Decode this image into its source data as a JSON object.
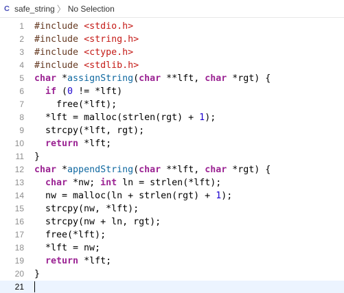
{
  "jump_bar": {
    "file_icon": "C",
    "file_name": "safe_string",
    "separator_icon": "chevron-right-icon",
    "separator_glyph": "〉",
    "selection": "No Selection"
  },
  "editor": {
    "current_line": 21,
    "lines": [
      {
        "number": "1",
        "tokens": [
          {
            "t": "pp",
            "v": "#include "
          },
          {
            "t": "str",
            "v": "<stdio.h>"
          }
        ]
      },
      {
        "number": "2",
        "tokens": [
          {
            "t": "pp",
            "v": "#include "
          },
          {
            "t": "str",
            "v": "<string.h>"
          }
        ]
      },
      {
        "number": "3",
        "tokens": [
          {
            "t": "pp",
            "v": "#include "
          },
          {
            "t": "str",
            "v": "<ctype.h>"
          }
        ]
      },
      {
        "number": "4",
        "tokens": [
          {
            "t": "pp",
            "v": "#include "
          },
          {
            "t": "str",
            "v": "<stdlib.h>"
          }
        ]
      },
      {
        "number": "5",
        "tokens": [
          {
            "t": "kw",
            "v": "char"
          },
          {
            "t": "plain",
            "v": " *"
          },
          {
            "t": "fn",
            "v": "assignString"
          },
          {
            "t": "plain",
            "v": "("
          },
          {
            "t": "kw",
            "v": "char"
          },
          {
            "t": "plain",
            "v": " **lft, "
          },
          {
            "t": "kw",
            "v": "char"
          },
          {
            "t": "plain",
            "v": " *rgt) {"
          }
        ]
      },
      {
        "number": "6",
        "tokens": [
          {
            "t": "plain",
            "v": "  "
          },
          {
            "t": "kw",
            "v": "if"
          },
          {
            "t": "plain",
            "v": " ("
          },
          {
            "t": "num",
            "v": "0"
          },
          {
            "t": "plain",
            "v": " != *lft)"
          }
        ]
      },
      {
        "number": "7",
        "tokens": [
          {
            "t": "plain",
            "v": "    free(*lft);"
          }
        ]
      },
      {
        "number": "8",
        "tokens": [
          {
            "t": "plain",
            "v": "  *lft = malloc(strlen(rgt) + "
          },
          {
            "t": "num",
            "v": "1"
          },
          {
            "t": "plain",
            "v": ");"
          }
        ]
      },
      {
        "number": "9",
        "tokens": [
          {
            "t": "plain",
            "v": "  strcpy(*lft, rgt);"
          }
        ]
      },
      {
        "number": "10",
        "tokens": [
          {
            "t": "plain",
            "v": "  "
          },
          {
            "t": "kw",
            "v": "return"
          },
          {
            "t": "plain",
            "v": " *lft;"
          }
        ]
      },
      {
        "number": "11",
        "tokens": [
          {
            "t": "plain",
            "v": "}"
          }
        ]
      },
      {
        "number": "12",
        "tokens": [
          {
            "t": "kw",
            "v": "char"
          },
          {
            "t": "plain",
            "v": " *"
          },
          {
            "t": "fn",
            "v": "appendString"
          },
          {
            "t": "plain",
            "v": "("
          },
          {
            "t": "kw",
            "v": "char"
          },
          {
            "t": "plain",
            "v": " **lft, "
          },
          {
            "t": "kw",
            "v": "char"
          },
          {
            "t": "plain",
            "v": " *rgt) {"
          }
        ]
      },
      {
        "number": "13",
        "tokens": [
          {
            "t": "plain",
            "v": "  "
          },
          {
            "t": "kw",
            "v": "char"
          },
          {
            "t": "plain",
            "v": " *nw; "
          },
          {
            "t": "kw",
            "v": "int"
          },
          {
            "t": "plain",
            "v": " ln = strlen(*lft);"
          }
        ]
      },
      {
        "number": "14",
        "tokens": [
          {
            "t": "plain",
            "v": "  nw = malloc(ln + strlen(rgt) + "
          },
          {
            "t": "num",
            "v": "1"
          },
          {
            "t": "plain",
            "v": ");"
          }
        ]
      },
      {
        "number": "15",
        "tokens": [
          {
            "t": "plain",
            "v": "  strcpy(nw, *lft);"
          }
        ]
      },
      {
        "number": "16",
        "tokens": [
          {
            "t": "plain",
            "v": "  strcpy(nw + ln, rgt);"
          }
        ]
      },
      {
        "number": "17",
        "tokens": [
          {
            "t": "plain",
            "v": "  free(*lft);"
          }
        ]
      },
      {
        "number": "18",
        "tokens": [
          {
            "t": "plain",
            "v": "  *lft = nw;"
          }
        ]
      },
      {
        "number": "19",
        "tokens": [
          {
            "t": "plain",
            "v": "  "
          },
          {
            "t": "kw",
            "v": "return"
          },
          {
            "t": "plain",
            "v": " *lft;"
          }
        ]
      },
      {
        "number": "20",
        "tokens": [
          {
            "t": "plain",
            "v": "}"
          }
        ]
      },
      {
        "number": "21",
        "tokens": []
      }
    ]
  },
  "colors": {
    "preprocessor": "#643820",
    "string": "#c41a16",
    "keyword": "#9b2393",
    "function": "#0f68a0",
    "number": "#1c00cf",
    "current_line_bg": "#ecf4ff"
  }
}
